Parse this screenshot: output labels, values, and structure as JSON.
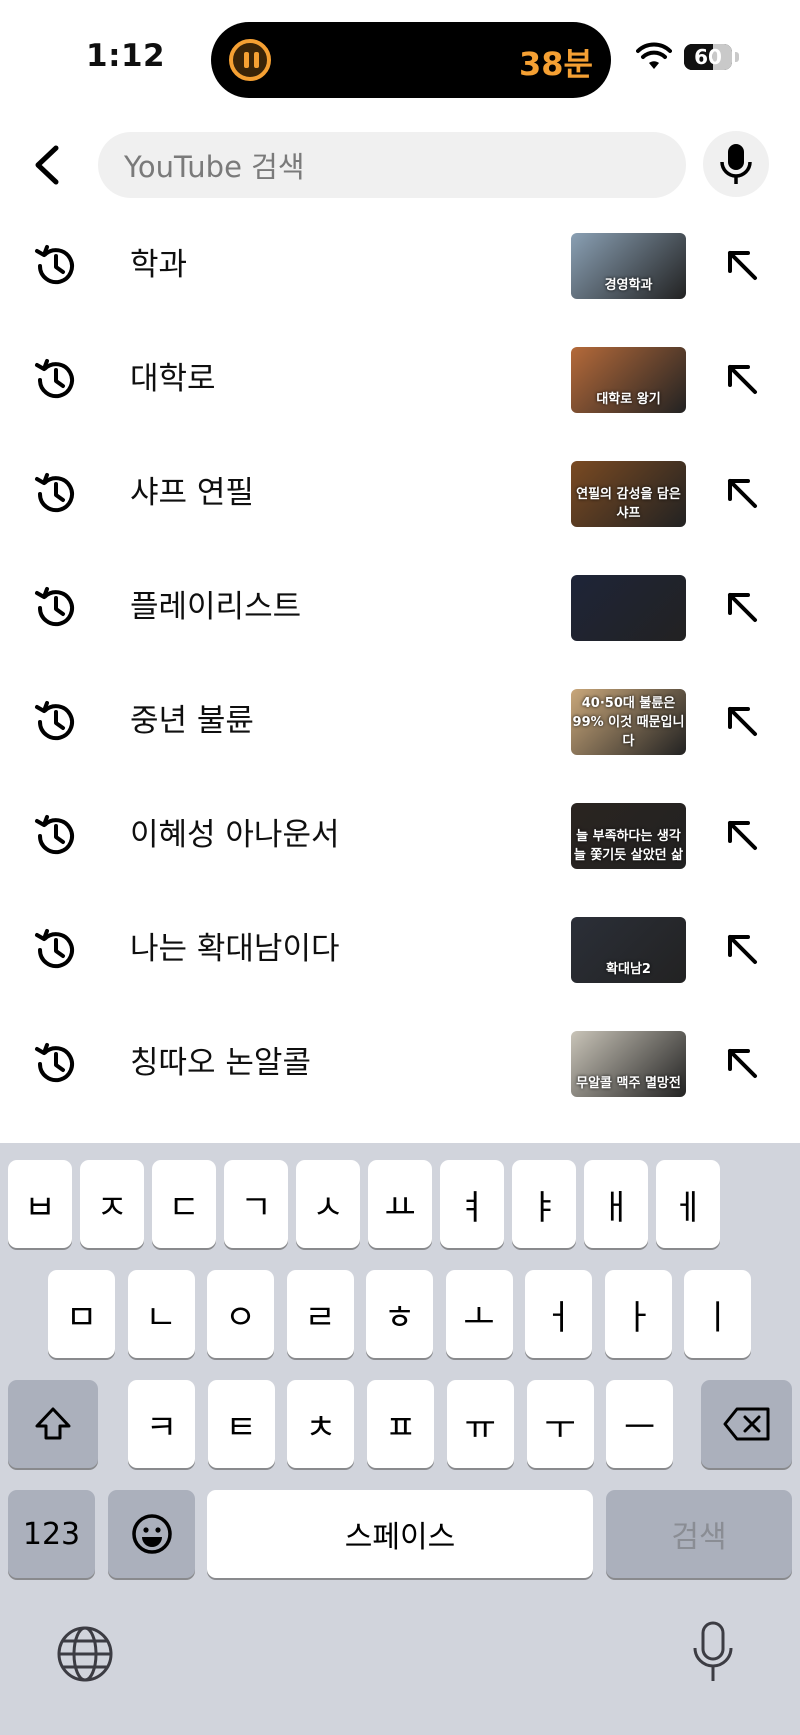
{
  "status_bar": {
    "time": "1:12",
    "timer": "38분",
    "battery": "60",
    "battery_level": 0.6
  },
  "search": {
    "placeholder": "YouTube 검색"
  },
  "history": [
    {
      "label": "학과",
      "thumb_text": "경영학과",
      "thumb_color": "#8aa0b4"
    },
    {
      "label": "대학로",
      "thumb_text": "대학로 왕기",
      "thumb_color": "#b56a3a"
    },
    {
      "label": "샤프 연필",
      "thumb_text": "연필의 감성을 담은 샤프",
      "thumb_color": "#7a4a22"
    },
    {
      "label": "플레이리스트",
      "thumb_text": "",
      "thumb_color": "#1e2438"
    },
    {
      "label": "중년 불륜",
      "thumb_text": "40·50대 불륜은 99% 이것 때문입니다",
      "thumb_color": "#c9a77a"
    },
    {
      "label": "이혜성 아나운서",
      "thumb_text": "늘 부족하다는 생각 늘 쫓기듯 살았던 삶",
      "thumb_color": "#2a2420"
    },
    {
      "label": "나는 확대남이다",
      "thumb_text": "확대남2",
      "thumb_color": "#2b2f38"
    },
    {
      "label": "칭따오 논알콜",
      "thumb_text": "무알콜 맥주 멸망전",
      "thumb_color": "#c9c4b8"
    }
  ],
  "keyboard": {
    "row1": [
      "ㅂ",
      "ㅈ",
      "ㄷ",
      "ㄱ",
      "ㅅ",
      "ㅛ",
      "ㅕ",
      "ㅑ",
      "ㅐ",
      "ㅔ"
    ],
    "row2": [
      "ㅁ",
      "ㄴ",
      "ㅇ",
      "ㄹ",
      "ㅎ",
      "ㅗ",
      "ㅓ",
      "ㅏ",
      "ㅣ"
    ],
    "row3": [
      "ㅋ",
      "ㅌ",
      "ㅊ",
      "ㅍ",
      "ㅠ",
      "ㅜ",
      "ㅡ"
    ],
    "numbers": "123",
    "space": "스페이스",
    "search": "검색"
  }
}
